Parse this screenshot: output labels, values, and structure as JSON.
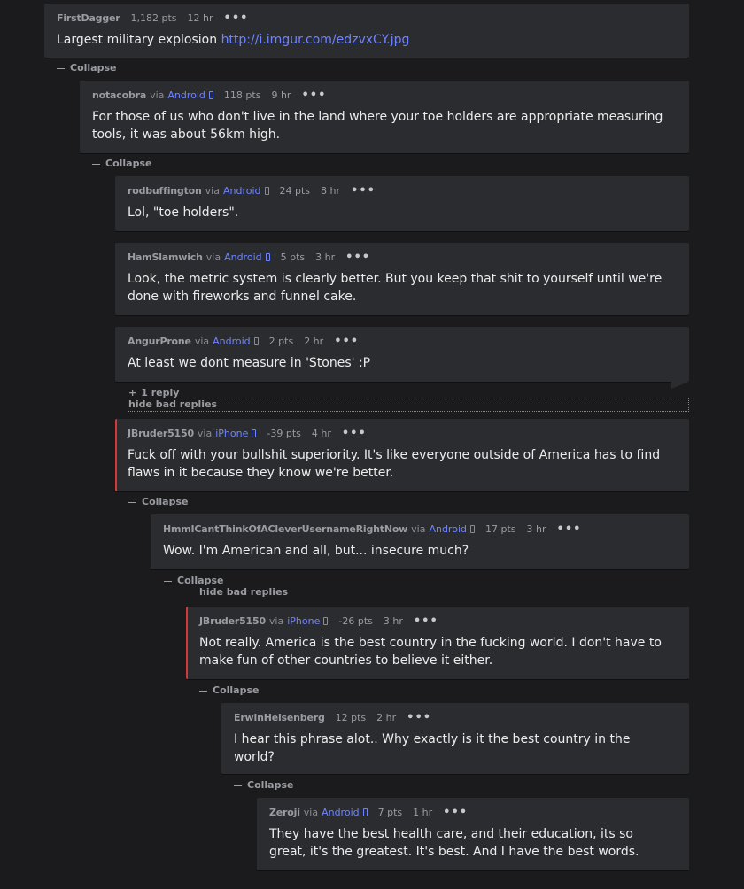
{
  "comments": [
    {
      "author": "FirstDagger",
      "via": "",
      "platform": "",
      "points": "1,182 pts",
      "time": "12 hr",
      "body": "Largest military explosion ",
      "link": "http://i.imgur.com/edzvxCY.jpg"
    },
    {
      "author": "notacobra",
      "via": "via",
      "platform": "Android",
      "points": "118 pts",
      "time": "9 hr",
      "body": "For those of us who don't live in the land where your toe holders are appropriate measuring\ntools, it was about 56km high."
    },
    {
      "author": "rodbuffington",
      "via": "via",
      "platform": "Android",
      "points": "24 pts",
      "time": "8 hr",
      "body": "Lol, \"toe holders\"."
    },
    {
      "author": "HamSlamwich",
      "via": "via",
      "platform": "Android",
      "points": "5 pts",
      "time": "3 hr",
      "body": "Look, the metric system is clearly better. But you keep that shit to yourself until we're\ndone with fireworks and funnel cake."
    },
    {
      "author": "AngurProne",
      "via": "via",
      "platform": "Android",
      "points": "2 pts",
      "time": "2 hr",
      "body": "At least we dont measure in 'Stones' :P"
    },
    {
      "author": "JBruder5150",
      "via": "via",
      "platform": "iPhone",
      "points": "-39 pts",
      "time": "4 hr",
      "body": "Fuck off with your bullshit superiority. It's like everyone outside of America has to find\nflaws in it because they know we're better."
    },
    {
      "author": "HmmICantThinkOfACleverUsernameRightNow",
      "via": "via",
      "platform": "Android",
      "points": "17 pts",
      "time": "3 hr",
      "body": "Wow. I'm American and all, but... insecure much?"
    },
    {
      "author": "JBruder5150",
      "via": "via",
      "platform": "iPhone",
      "points": "-26 pts",
      "time": "3 hr",
      "body": "Not really. America is the best country in the fucking world. I don't have to\nmake fun of other countries to believe it either."
    },
    {
      "author": "ErwinHeisenberg",
      "via": "",
      "platform": "",
      "points": "12 pts",
      "time": "2 hr",
      "body": "I hear this phrase alot.. Why exactly is it the best country in the\nworld?"
    },
    {
      "author": "Zeroji",
      "via": "via",
      "platform": "Android",
      "points": "7 pts",
      "time": "1 hr",
      "body": "They have the best health care, and their education, its so\ngreat, it's the greatest. It's best. And I have the best words."
    }
  ],
  "labels": {
    "collapse": "Collapse",
    "more": "•••",
    "one_reply": "1 reply",
    "hide_bad_replies": "hide bad replies"
  }
}
